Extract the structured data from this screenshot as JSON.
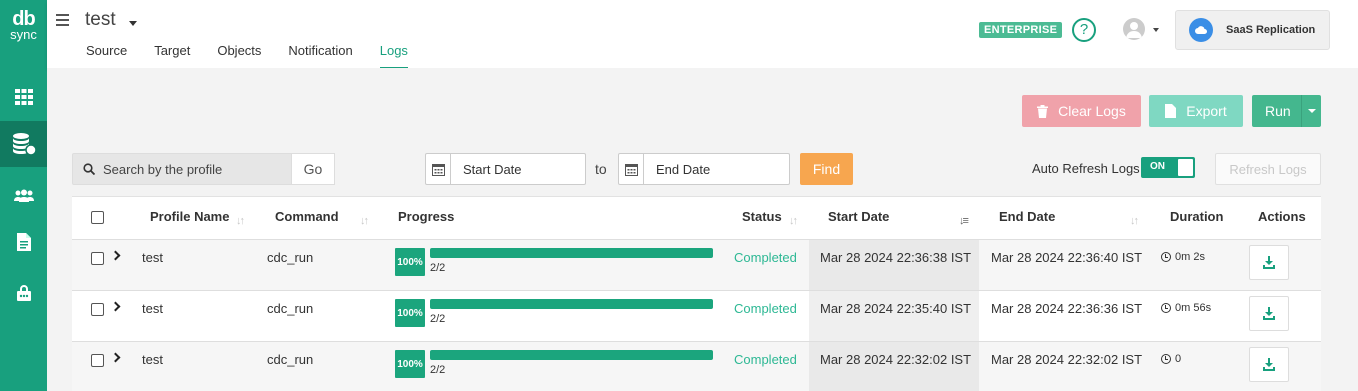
{
  "sidebar": {
    "logo_mark": "db",
    "logo_text": "sync",
    "items": [
      "apps-icon",
      "database-icon",
      "users-icon",
      "document-icon",
      "lock-icon"
    ]
  },
  "header": {
    "title": "test",
    "tabs": [
      {
        "label": "Source"
      },
      {
        "label": "Target"
      },
      {
        "label": "Objects"
      },
      {
        "label": "Notification"
      },
      {
        "label": "Logs",
        "active": true
      }
    ],
    "enterprise_badge": "ENTERPRISE",
    "help_label": "?",
    "saas_label": "SaaS Replication"
  },
  "toolbar": {
    "clear_logs": "Clear Logs",
    "export": "Export",
    "run": "Run"
  },
  "filters": {
    "search_placeholder": "Search by the profile",
    "go": "Go",
    "start_placeholder": "Start Date",
    "to": "to",
    "end_placeholder": "End Date",
    "find": "Find",
    "auto_refresh_label": "Auto Refresh Logs",
    "auto_refresh_state": "ON",
    "refresh_logs": "Refresh Logs"
  },
  "table": {
    "columns": {
      "profile": "Profile Name",
      "command": "Command",
      "progress": "Progress",
      "status": "Status",
      "start": "Start Date",
      "end": "End Date",
      "duration": "Duration",
      "actions": "Actions"
    },
    "rows": [
      {
        "profile": "test",
        "command": "cdc_run",
        "percent": "100%",
        "fraction": 1.0,
        "count": "2/2",
        "status": "Completed",
        "start": "Mar 28 2024 22:36:38 IST",
        "end": "Mar 28 2024 22:36:40 IST",
        "duration": "0m 2s"
      },
      {
        "profile": "test",
        "command": "cdc_run",
        "percent": "100%",
        "fraction": 1.0,
        "count": "2/2",
        "status": "Completed",
        "start": "Mar 28 2024 22:35:40 IST",
        "end": "Mar 28 2024 22:36:36 IST",
        "duration": "0m 56s"
      },
      {
        "profile": "test",
        "command": "cdc_run",
        "percent": "100%",
        "fraction": 1.0,
        "count": "2/2",
        "status": "Completed",
        "start": "Mar 28 2024 22:32:02 IST",
        "end": "Mar 28 2024 22:32:02 IST",
        "duration": "0"
      }
    ]
  },
  "colors": {
    "brand": "#18a07e",
    "clear": "#f0a2aa",
    "export": "#7fd8c2",
    "run": "#44b78e",
    "find": "#f7a64f"
  }
}
